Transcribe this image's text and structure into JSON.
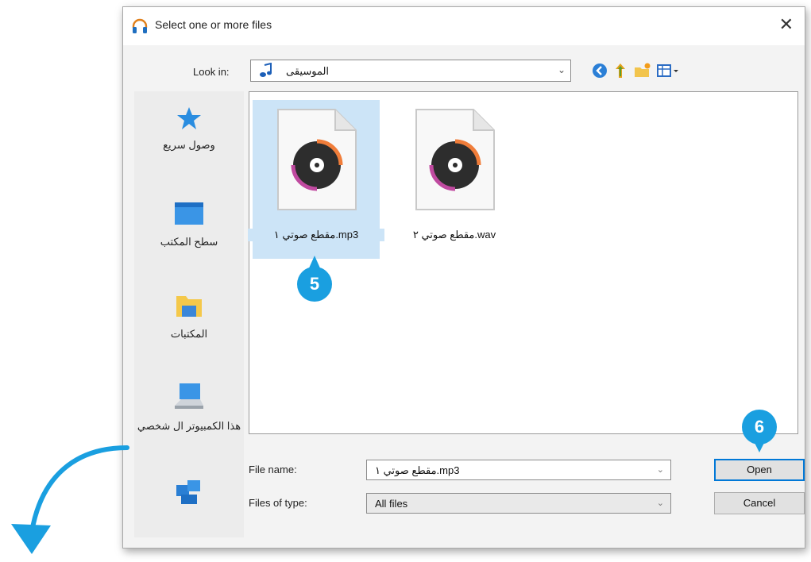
{
  "dialog": {
    "title": "Select one or more files",
    "close_glyph": "✕"
  },
  "toolbar": {
    "look_in_label": "Look in:",
    "look_in_value": "الموسيقى",
    "icons": [
      "back-icon",
      "up-folder-icon",
      "new-folder-icon",
      "view-menu-icon"
    ]
  },
  "sidebar": {
    "items": [
      {
        "label": "وصول سريع",
        "icon": "star-icon"
      },
      {
        "label": "سطح المكتب",
        "icon": "desktop-icon"
      },
      {
        "label": "المكتبات",
        "icon": "libraries-icon"
      },
      {
        "label": "هذا الكمبيوتر ال شخصي",
        "icon": "this-pc-icon"
      },
      {
        "label": "",
        "icon": "network-icon"
      }
    ]
  },
  "files": [
    {
      "name": "مقطع صوتي ١.mp3",
      "selected": true
    },
    {
      "name": "مقطع صوتي ٢.wav",
      "selected": false
    }
  ],
  "steps": {
    "step5": "5",
    "step6": "6"
  },
  "bottom": {
    "file_name_label": "File name:",
    "file_name_value": "مقطع صوتي ١.mp3",
    "file_type_label": "Files of type:",
    "file_type_value": "All files",
    "open_label": "Open",
    "cancel_label": "Cancel"
  },
  "colors": {
    "accent": "#1a9fe0",
    "selection": "#cce4f7",
    "default_button_border": "#0078d7"
  }
}
